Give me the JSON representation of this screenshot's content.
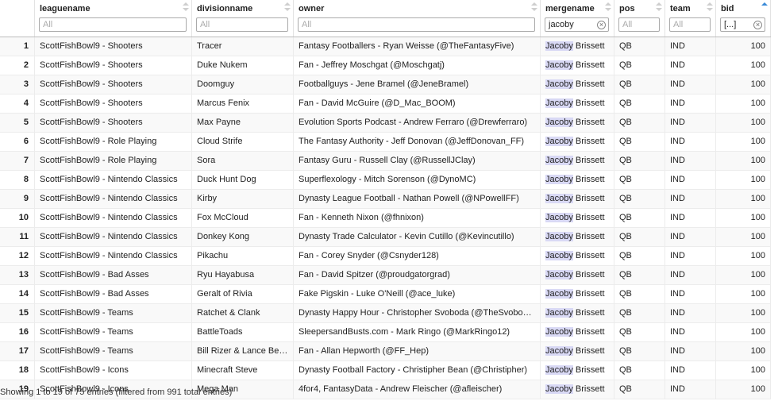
{
  "columns": [
    {
      "key": "idx",
      "label": ""
    },
    {
      "key": "leaguename",
      "label": "leaguename",
      "filter_placeholder": "All",
      "filter_value": ""
    },
    {
      "key": "divisionname",
      "label": "divisionname",
      "filter_placeholder": "All",
      "filter_value": ""
    },
    {
      "key": "owner",
      "label": "owner",
      "filter_placeholder": "All",
      "filter_value": ""
    },
    {
      "key": "mergename",
      "label": "mergename",
      "filter_placeholder": "All",
      "filter_value": "jacoby"
    },
    {
      "key": "pos",
      "label": "pos",
      "filter_placeholder": "All",
      "filter_value": ""
    },
    {
      "key": "team",
      "label": "team",
      "filter_placeholder": "All",
      "filter_value": ""
    },
    {
      "key": "bid",
      "label": "bid",
      "filter_placeholder": "All",
      "filter_value": "[...]"
    }
  ],
  "sort": {
    "column": "bid",
    "direction": "asc"
  },
  "highlight_term": "Jacoby",
  "rows": [
    {
      "idx": "1",
      "leaguename": "ScottFishBowl9 - Shooters",
      "divisionname": "Tracer",
      "owner": "Fantasy Footballers - Ryan Weisse (@TheFantasyFive)",
      "mergename": "Jacoby Brissett",
      "pos": "QB",
      "team": "IND",
      "bid": "100"
    },
    {
      "idx": "2",
      "leaguename": "ScottFishBowl9 - Shooters",
      "divisionname": "Duke Nukem",
      "owner": "Fan - Jeffrey Moschgat (@Moschgatj)",
      "mergename": "Jacoby Brissett",
      "pos": "QB",
      "team": "IND",
      "bid": "100"
    },
    {
      "idx": "3",
      "leaguename": "ScottFishBowl9 - Shooters",
      "divisionname": "Doomguy",
      "owner": "Footballguys - Jene Bramel (@JeneBramel)",
      "mergename": "Jacoby Brissett",
      "pos": "QB",
      "team": "IND",
      "bid": "100"
    },
    {
      "idx": "4",
      "leaguename": "ScottFishBowl9 - Shooters",
      "divisionname": "Marcus Fenix",
      "owner": "Fan - David McGuire (@D_Mac_BOOM)",
      "mergename": "Jacoby Brissett",
      "pos": "QB",
      "team": "IND",
      "bid": "100"
    },
    {
      "idx": "5",
      "leaguename": "ScottFishBowl9 - Shooters",
      "divisionname": "Max Payne",
      "owner": "Evolution Sports Podcast - Andrew Ferraro (@Drewferraro)",
      "mergename": "Jacoby Brissett",
      "pos": "QB",
      "team": "IND",
      "bid": "100"
    },
    {
      "idx": "6",
      "leaguename": "ScottFishBowl9 - Role Playing",
      "divisionname": "Cloud Strife",
      "owner": "The Fantasy Authority - Jeff Donovan (@JeffDonovan_FF)",
      "mergename": "Jacoby Brissett",
      "pos": "QB",
      "team": "IND",
      "bid": "100"
    },
    {
      "idx": "7",
      "leaguename": "ScottFishBowl9 - Role Playing",
      "divisionname": "Sora",
      "owner": "Fantasy Guru - Russell Clay (@RussellJClay)",
      "mergename": "Jacoby Brissett",
      "pos": "QB",
      "team": "IND",
      "bid": "100"
    },
    {
      "idx": "8",
      "leaguename": "ScottFishBowl9 - Nintendo Classics",
      "divisionname": "Duck Hunt Dog",
      "owner": "Superflexology - Mitch Sorenson (@DynoMC)",
      "mergename": "Jacoby Brissett",
      "pos": "QB",
      "team": "IND",
      "bid": "100"
    },
    {
      "idx": "9",
      "leaguename": "ScottFishBowl9 - Nintendo Classics",
      "divisionname": "Kirby",
      "owner": "Dynasty League Football - Nathan Powell (@NPowellFF)",
      "mergename": "Jacoby Brissett",
      "pos": "QB",
      "team": "IND",
      "bid": "100"
    },
    {
      "idx": "10",
      "leaguename": "ScottFishBowl9 - Nintendo Classics",
      "divisionname": "Fox McCloud",
      "owner": "Fan - Kenneth Nixon (@fhnixon)",
      "mergename": "Jacoby Brissett",
      "pos": "QB",
      "team": "IND",
      "bid": "100"
    },
    {
      "idx": "11",
      "leaguename": "ScottFishBowl9 - Nintendo Classics",
      "divisionname": "Donkey Kong",
      "owner": "Dynasty Trade Calculator - Kevin Cutillo (@Kevincutillo)",
      "mergename": "Jacoby Brissett",
      "pos": "QB",
      "team": "IND",
      "bid": "100"
    },
    {
      "idx": "12",
      "leaguename": "ScottFishBowl9 - Nintendo Classics",
      "divisionname": "Pikachu",
      "owner": "Fan - Corey Snyder (@Csnyder128)",
      "mergename": "Jacoby Brissett",
      "pos": "QB",
      "team": "IND",
      "bid": "100"
    },
    {
      "idx": "13",
      "leaguename": "ScottFishBowl9 - Bad Asses",
      "divisionname": "Ryu Hayabusa",
      "owner": "Fan - David Spitzer (@proudgatorgrad)",
      "mergename": "Jacoby Brissett",
      "pos": "QB",
      "team": "IND",
      "bid": "100"
    },
    {
      "idx": "14",
      "leaguename": "ScottFishBowl9 - Bad Asses",
      "divisionname": "Geralt of Rivia",
      "owner": "Fake Pigskin - Luke O'Neill (@ace_luke)",
      "mergename": "Jacoby Brissett",
      "pos": "QB",
      "team": "IND",
      "bid": "100"
    },
    {
      "idx": "15",
      "leaguename": "ScottFishBowl9 - Teams",
      "divisionname": "Ratchet & Clank",
      "owner": "Dynasty Happy Hour - Christopher Svoboda (@TheSvoboda)",
      "mergename": "Jacoby Brissett",
      "pos": "QB",
      "team": "IND",
      "bid": "100"
    },
    {
      "idx": "16",
      "leaguename": "ScottFishBowl9 - Teams",
      "divisionname": "BattleToads",
      "owner": "SleepersandBusts.com - Mark Ringo (@MarkRingo12)",
      "mergename": "Jacoby Brissett",
      "pos": "QB",
      "team": "IND",
      "bid": "100"
    },
    {
      "idx": "17",
      "leaguename": "ScottFishBowl9 - Teams",
      "divisionname": "Bill Rizer & Lance Bean",
      "owner": "Fan - Allan Hepworth (@FF_Hep)",
      "mergename": "Jacoby Brissett",
      "pos": "QB",
      "team": "IND",
      "bid": "100"
    },
    {
      "idx": "18",
      "leaguename": "ScottFishBowl9 - Icons",
      "divisionname": "Minecraft Steve",
      "owner": "Dynasty Football Factory - Christipher Bean (@Christipher)",
      "mergename": "Jacoby Brissett",
      "pos": "QB",
      "team": "IND",
      "bid": "100"
    },
    {
      "idx": "19",
      "leaguename": "ScottFishBowl9 - Icons",
      "divisionname": "Mega Man",
      "owner": "4for4, FantasyData - Andrew Fleischer (@afleischer)",
      "mergename": "Jacoby Brissett",
      "pos": "QB",
      "team": "IND",
      "bid": "100"
    }
  ],
  "footer": {
    "info": "Showing 1 to 19 of 75 entries (filtered from 991 total entries)"
  }
}
